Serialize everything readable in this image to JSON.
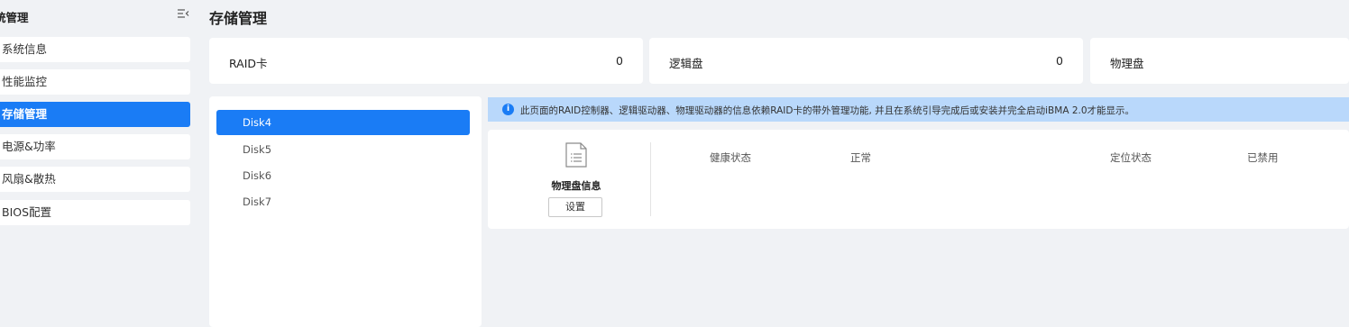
{
  "sidebar": {
    "title": "统管理",
    "items": [
      {
        "label": "系统信息",
        "active": false
      },
      {
        "label": "性能监控",
        "active": false
      },
      {
        "label": "存储管理",
        "active": true
      },
      {
        "label": "电源&功率",
        "active": false
      },
      {
        "label": "风扇&散热",
        "active": false
      },
      {
        "label": "BIOS配置",
        "active": false
      }
    ]
  },
  "page": {
    "title": "存储管理"
  },
  "summary": {
    "raid": {
      "label": "RAID卡",
      "value": "0"
    },
    "logical": {
      "label": "逻辑盘",
      "value": "0"
    },
    "physical": {
      "label": "物理盘",
      "value": ""
    }
  },
  "disks": [
    {
      "label": "Disk4",
      "active": true
    },
    {
      "label": "Disk5",
      "active": false
    },
    {
      "label": "Disk6",
      "active": false
    },
    {
      "label": "Disk7",
      "active": false
    }
  ],
  "banner": {
    "icon": "info-icon",
    "text": "此页面的RAID控制器、逻辑驱动器、物理驱动器的信息依赖RAID卡的带外管理功能, 并且在系统引导完成后或安装并完全启动iBMA 2.0才能显示。"
  },
  "detail": {
    "icon": "document-icon",
    "title": "物理盘信息",
    "settings_label": "设置",
    "health_label": "健康状态",
    "health_value": "正常",
    "locate_label": "定位状态",
    "locate_value": "已禁用"
  },
  "colors": {
    "accent": "#1a7cf5",
    "banner_bg": "#b9d8fb",
    "page_bg": "#f0f2f5"
  }
}
